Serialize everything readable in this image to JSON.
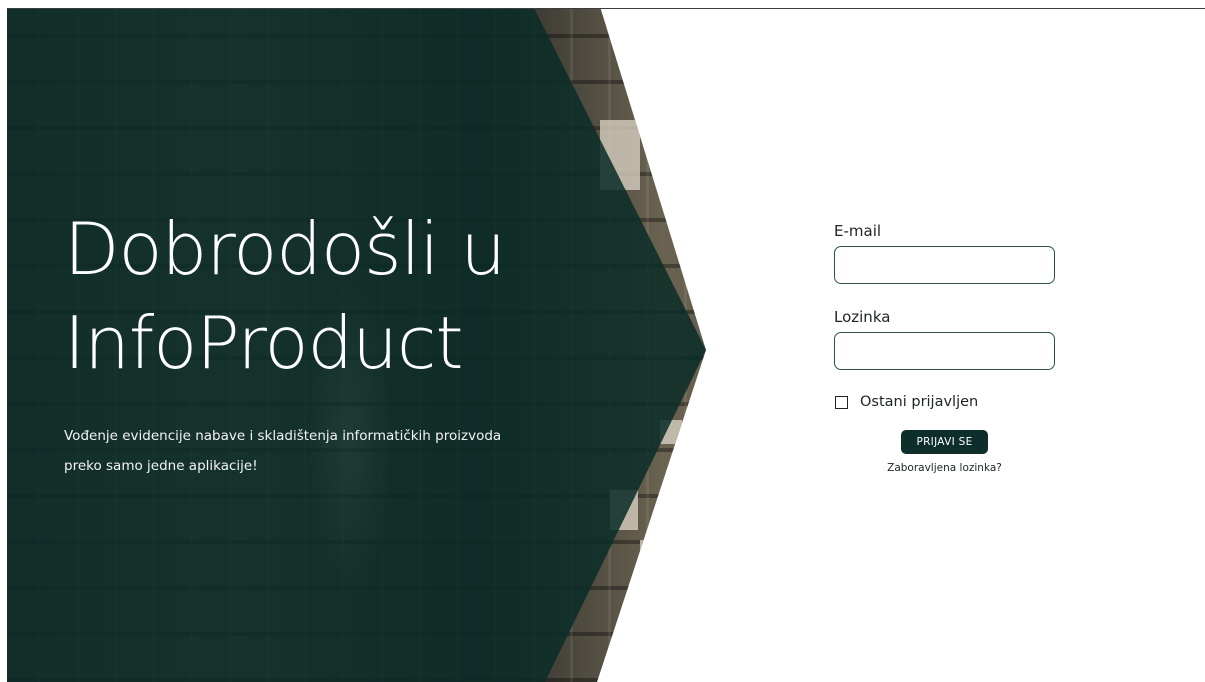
{
  "hero": {
    "title": "Dobrodošli u\nInfoProduct",
    "subtitle": "Vođenje evidencije nabave i skladištenja informatičkih proizvoda preko samo jedne aplikacije!"
  },
  "login": {
    "email_label": "E-mail",
    "email_value": "",
    "password_label": "Lozinka",
    "password_value": "",
    "remember_label": "Ostani prijavljen",
    "remember_checked": false,
    "submit_label": "PRIJAVI SE",
    "forgot_label": "Zaboravljena lozinka?"
  },
  "colors": {
    "overlay": "#0a2c28",
    "button": "#0d2e2a",
    "input_border": "#2f4f4a",
    "text": "#1d2523"
  }
}
